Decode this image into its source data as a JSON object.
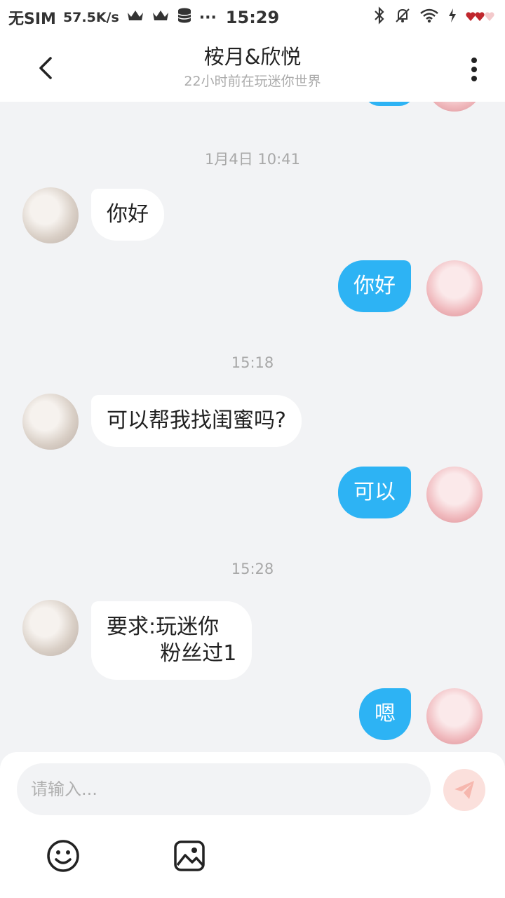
{
  "status_bar": {
    "carrier": "无SIM",
    "speed": "57.5K/s",
    "time": "15:29",
    "more": "···"
  },
  "header": {
    "title": "桉月&欣悦",
    "subtitle": "22小时前在玩迷你世界"
  },
  "messages": [
    {
      "type": "timestamp",
      "text": "1月4日 10:41"
    },
    {
      "type": "in",
      "text": "你好"
    },
    {
      "type": "out",
      "text": "你好"
    },
    {
      "type": "timestamp",
      "text": "15:18"
    },
    {
      "type": "in",
      "text": "可以帮我找闺蜜吗?"
    },
    {
      "type": "out",
      "text": "可以"
    },
    {
      "type": "timestamp",
      "text": "15:28"
    },
    {
      "type": "in",
      "text": "要求:玩迷你\n        粉丝过1"
    },
    {
      "type": "out",
      "text": "嗯"
    }
  ],
  "input": {
    "placeholder": "请输入..."
  },
  "colors": {
    "outgoing_bubble": "#2db3f4",
    "incoming_bubble": "#ffffff",
    "background": "#f2f3f5",
    "send_button": "#fbe0dc"
  },
  "icons": [
    "back-arrow-icon",
    "more-vertical-icon",
    "send-icon",
    "emoji-icon",
    "image-icon"
  ]
}
